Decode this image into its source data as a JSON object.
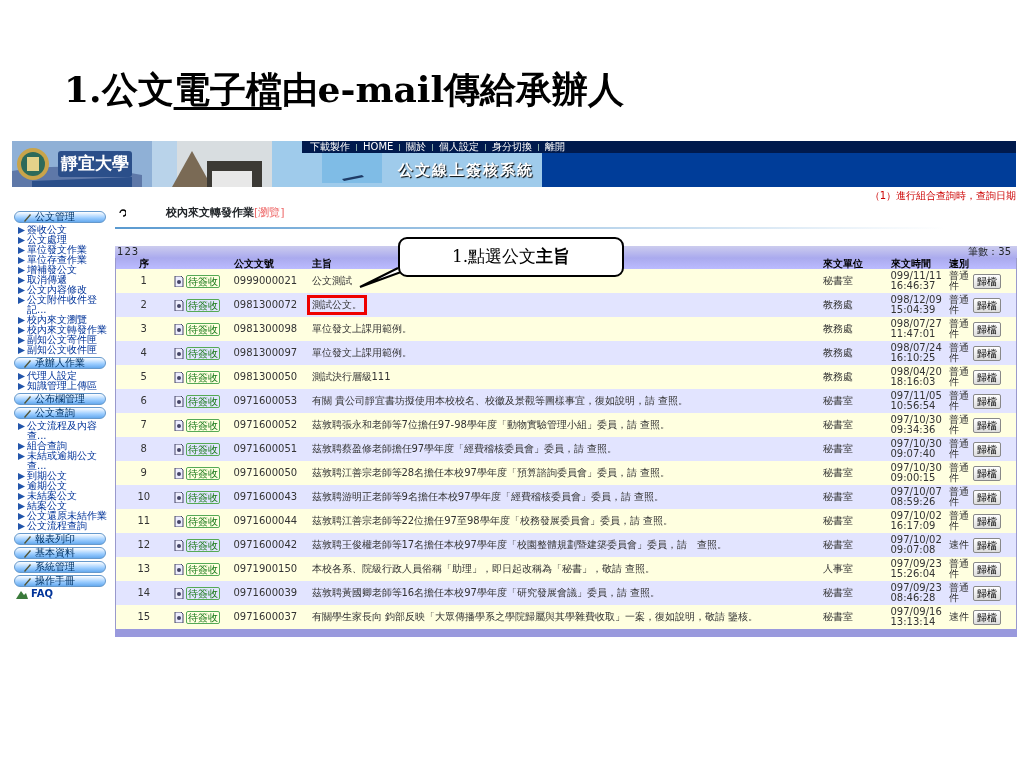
{
  "slide_title": {
    "before": "1.公文",
    "underlined": "電子檔",
    "after": "由e-mail傳給承辦人"
  },
  "banner": {
    "school": "靜宜大學",
    "links": [
      "下載製作",
      "HOME",
      "關於",
      "個人設定",
      "身分切換",
      "離開"
    ],
    "system_title": "公文線上簽核系統"
  },
  "notice": "（1）進行組合查詢時，查詢日期",
  "sidebar": [
    {
      "kind": "header",
      "label": "公文管理"
    },
    {
      "kind": "item",
      "label": "簽收公文"
    },
    {
      "kind": "item",
      "label": "公文處理"
    },
    {
      "kind": "item",
      "label": "單位發文作業"
    },
    {
      "kind": "item",
      "label": "單位存查作業"
    },
    {
      "kind": "item",
      "label": "增補發公文"
    },
    {
      "kind": "item",
      "label": "取消傳遞"
    },
    {
      "kind": "item",
      "label": "公文內容修改"
    },
    {
      "kind": "item",
      "label": "公文附件收件登記..."
    },
    {
      "kind": "item",
      "label": "校內來文瀏覽"
    },
    {
      "kind": "item",
      "label": "校內來文轉發作業"
    },
    {
      "kind": "item",
      "label": "副知公文寄件匣"
    },
    {
      "kind": "item",
      "label": "副知公文收件匣"
    },
    {
      "kind": "header",
      "label": "承辦人作業"
    },
    {
      "kind": "item",
      "label": "代理人設定"
    },
    {
      "kind": "item",
      "label": "知識管理上傳區"
    },
    {
      "kind": "header",
      "label": "公布欄管理"
    },
    {
      "kind": "header",
      "label": "公文查詢"
    },
    {
      "kind": "item",
      "label": "公文流程及內容查..."
    },
    {
      "kind": "item",
      "label": "組合查詢"
    },
    {
      "kind": "item",
      "label": "未結或逾期公文查..."
    },
    {
      "kind": "item",
      "label": "到期公文"
    },
    {
      "kind": "item",
      "label": "逾期公文"
    },
    {
      "kind": "item",
      "label": "未結案公文"
    },
    {
      "kind": "item",
      "label": "結案公文"
    },
    {
      "kind": "item",
      "label": "公文還原未結作業"
    },
    {
      "kind": "item",
      "label": "公文流程查詢"
    },
    {
      "kind": "header",
      "label": "報表列印"
    },
    {
      "kind": "header",
      "label": "基本資料"
    },
    {
      "kind": "header",
      "label": "系統管理"
    },
    {
      "kind": "header",
      "label": "操作手冊"
    },
    {
      "kind": "link",
      "label": "FAQ"
    }
  ],
  "page": {
    "title": "校內來文轉發作業",
    "mode": "[瀏覽]"
  },
  "pager": {
    "pages": [
      "1",
      "2",
      "3"
    ],
    "count": "筆數：35"
  },
  "table": {
    "columns": [
      "序",
      "公文文號",
      "主旨",
      "來文單位",
      "來文時間",
      "速別"
    ],
    "rows": [
      {
        "no": "1",
        "status": "待簽收",
        "doc_no": "0999000021",
        "subject": "公文測試",
        "unit": "秘書室",
        "date": "099/11/11",
        "time": "16:46:37",
        "speed": "普通件",
        "action": "歸檔",
        "highlighted": false
      },
      {
        "no": "2",
        "status": "待簽收",
        "doc_no": "0981300072",
        "subject": "測試公文。",
        "unit": "教務處",
        "date": "098/12/09",
        "time": "15:04:39",
        "speed": "普通件",
        "action": "歸檔",
        "highlighted": true
      },
      {
        "no": "3",
        "status": "待簽收",
        "doc_no": "0981300098",
        "subject": "單位發文上課用範例。",
        "unit": "教務處",
        "date": "098/07/27",
        "time": "11:47:01",
        "speed": "普通件",
        "action": "歸檔",
        "highlighted": false
      },
      {
        "no": "4",
        "status": "待簽收",
        "doc_no": "0981300097",
        "subject": "單位發文上課用範例。",
        "unit": "教務處",
        "date": "098/07/24",
        "time": "16:10:25",
        "speed": "普通件",
        "action": "歸檔",
        "highlighted": false
      },
      {
        "no": "5",
        "status": "待簽收",
        "doc_no": "0981300050",
        "subject": "測試決行層級111",
        "unit": "教務處",
        "date": "098/04/20",
        "time": "18:16:03",
        "speed": "普通件",
        "action": "歸檔",
        "highlighted": false
      },
      {
        "no": "6",
        "status": "待簽收",
        "doc_no": "0971600053",
        "subject": "有關 貴公司靜宜書坊擬使用本校校名、校徽及景觀等圖樣事宜，復如說明，請 查照。",
        "unit": "秘書室",
        "date": "097/11/05",
        "time": "10:56:54",
        "speed": "普通件",
        "action": "歸檔",
        "highlighted": false
      },
      {
        "no": "7",
        "status": "待簽收",
        "doc_no": "0971600052",
        "subject": "茲敦聘張永和老師等7位擔任97-98學年度「動物實驗管理小組」委員，請 查照。",
        "unit": "秘書室",
        "date": "097/10/30",
        "time": "09:34:36",
        "speed": "普通件",
        "action": "歸檔",
        "highlighted": false
      },
      {
        "no": "8",
        "status": "待簽收",
        "doc_no": "0971600051",
        "subject": "茲敦聘蔡盈修老師擔任97學年度「經費稽核委員會」委員，請 查照。",
        "unit": "秘書室",
        "date": "097/10/30",
        "time": "09:07:40",
        "speed": "普通件",
        "action": "歸檔",
        "highlighted": false
      },
      {
        "no": "9",
        "status": "待簽收",
        "doc_no": "0971600050",
        "subject": "茲敦聘江善宗老師等28名擔任本校97學年度「預算諮詢委員會」委員，請 查照。",
        "unit": "秘書室",
        "date": "097/10/30",
        "time": "09:00:15",
        "speed": "普通件",
        "action": "歸檔",
        "highlighted": false
      },
      {
        "no": "10",
        "status": "待簽收",
        "doc_no": "0971600043",
        "subject": "茲敦聘游明正老師等9名擔任本校97學年度「經費稽核委員會」委員，請 查照。",
        "unit": "秘書室",
        "date": "097/10/07",
        "time": "08:59:26",
        "speed": "普通件",
        "action": "歸檔",
        "highlighted": false
      },
      {
        "no": "11",
        "status": "待簽收",
        "doc_no": "0971600044",
        "subject": "茲敦聘江善宗老師等22位擔任97至98學年度「校務發展委員會」委員，請 查照。",
        "unit": "秘書室",
        "date": "097/10/02",
        "time": "16:17:09",
        "speed": "普通件",
        "action": "歸檔",
        "highlighted": false
      },
      {
        "no": "12",
        "status": "待簽收",
        "doc_no": "0971600042",
        "subject": "茲敦聘王俊權老師等17名擔任本校97學年度「校園整體規劃暨建築委員會」委員，請　查照。",
        "unit": "秘書室",
        "date": "097/10/02",
        "time": "09:07:08",
        "speed": "速件",
        "action": "歸檔",
        "highlighted": false
      },
      {
        "no": "13",
        "status": "待簽收",
        "doc_no": "0971900150",
        "subject": "本校各系、院級行政人員俗稱「助理」，即日起改稱為「秘書」，敬請 查照。",
        "unit": "人事室",
        "date": "097/09/23",
        "time": "15:26:04",
        "speed": "普通件",
        "action": "歸檔",
        "highlighted": false
      },
      {
        "no": "14",
        "status": "待簽收",
        "doc_no": "0971600039",
        "subject": "茲敦聘黃國卿老師等16名擔任本校97學年度「研究發展會議」委員，請 查照。",
        "unit": "秘書室",
        "date": "097/09/23",
        "time": "08:46:28",
        "speed": "普通件",
        "action": "歸檔",
        "highlighted": false
      },
      {
        "no": "15",
        "status": "待簽收",
        "doc_no": "0971600037",
        "subject": "有關學生家長向 鈞部反映「大眾傳播學系之學院歸屬與其學雜費收取」一案，復如說明，敬請 鑒核。",
        "unit": "秘書室",
        "date": "097/09/16",
        "time": "13:13:14",
        "speed": "速件",
        "action": "歸檔",
        "highlighted": false
      }
    ]
  },
  "callout": {
    "text": "1.點選公文**主旨**"
  }
}
